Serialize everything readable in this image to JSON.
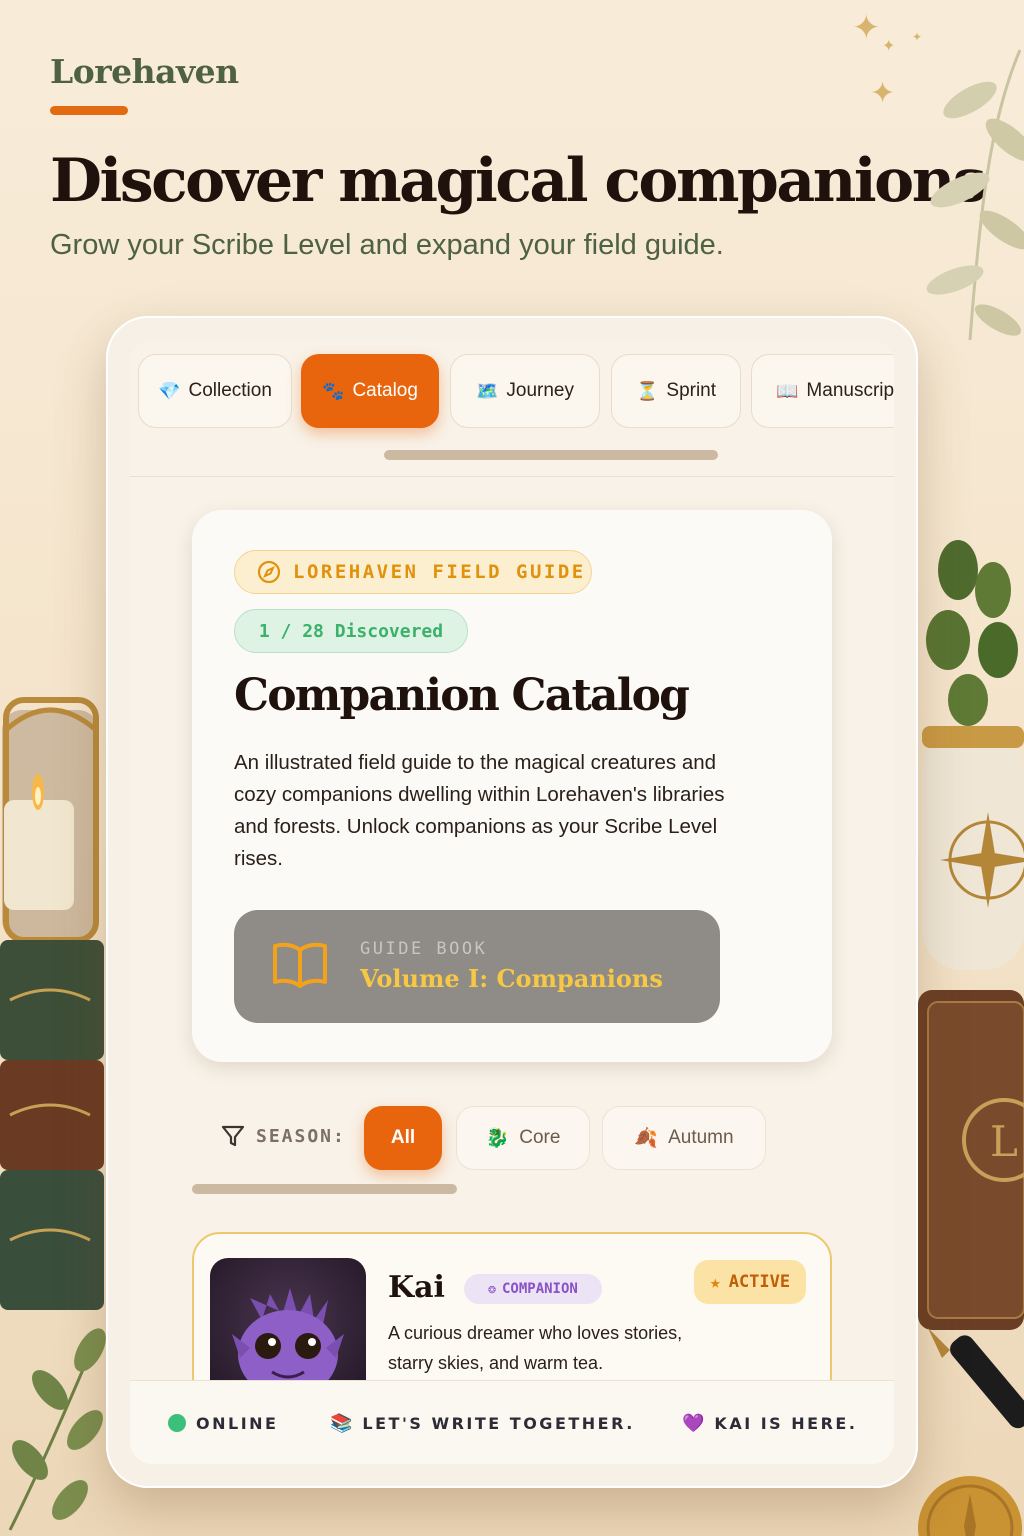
{
  "brand": "Lorehaven",
  "headline": "Discover magical companions",
  "subhead": "Grow your Scribe Level and expand your field guide.",
  "tabs": [
    {
      "label": "Collection",
      "icon": "💎",
      "icon_name": "gem-icon",
      "active": false
    },
    {
      "label": "Catalog",
      "icon": "🐾",
      "icon_name": "paw-icon",
      "active": true
    },
    {
      "label": "Journey",
      "icon": "🗺️",
      "icon_name": "map-icon",
      "active": false
    },
    {
      "label": "Sprint",
      "icon": "⏳",
      "icon_name": "hourglass-icon",
      "active": false
    },
    {
      "label": "Manuscript",
      "icon": "📖",
      "icon_name": "open-book-icon",
      "active": false
    }
  ],
  "hero": {
    "guide_chip": "LOREHAVEN FIELD GUIDE",
    "discovered": "1 / 28 Discovered",
    "title": "Companion Catalog",
    "description": "An illustrated field guide to the magical creatures and cozy companions dwelling within Lorehaven's libraries and forests. Unlock companions as your Scribe Level rises.",
    "guide_book": {
      "label": "GUIDE BOOK",
      "title": "Volume I: Companions"
    }
  },
  "filters": {
    "label": "SEASON:",
    "options": [
      {
        "label": "All",
        "icon": "",
        "active": true
      },
      {
        "label": "Core",
        "icon": "🐉",
        "icon_name": "dragon-icon",
        "active": false
      },
      {
        "label": "Autumn",
        "icon": "🍂",
        "icon_name": "autumn-leaves-icon",
        "active": false
      }
    ]
  },
  "companion": {
    "name": "Kai",
    "badge": "COMPANION",
    "status": "ACTIVE",
    "description": "A curious dreamer who loves stories, starry skies, and warm tea."
  },
  "status_bar": {
    "online": "ONLINE",
    "message": "LET'S WRITE TOGETHER.",
    "message_icon": "📚",
    "presence": "KAI IS HERE.",
    "presence_icon": "💜"
  },
  "colors": {
    "accent": "#e8650d",
    "brand_green": "#4e6142",
    "gold": "#e0920f",
    "success": "#3bb16a",
    "purple": "#8a52c7"
  }
}
